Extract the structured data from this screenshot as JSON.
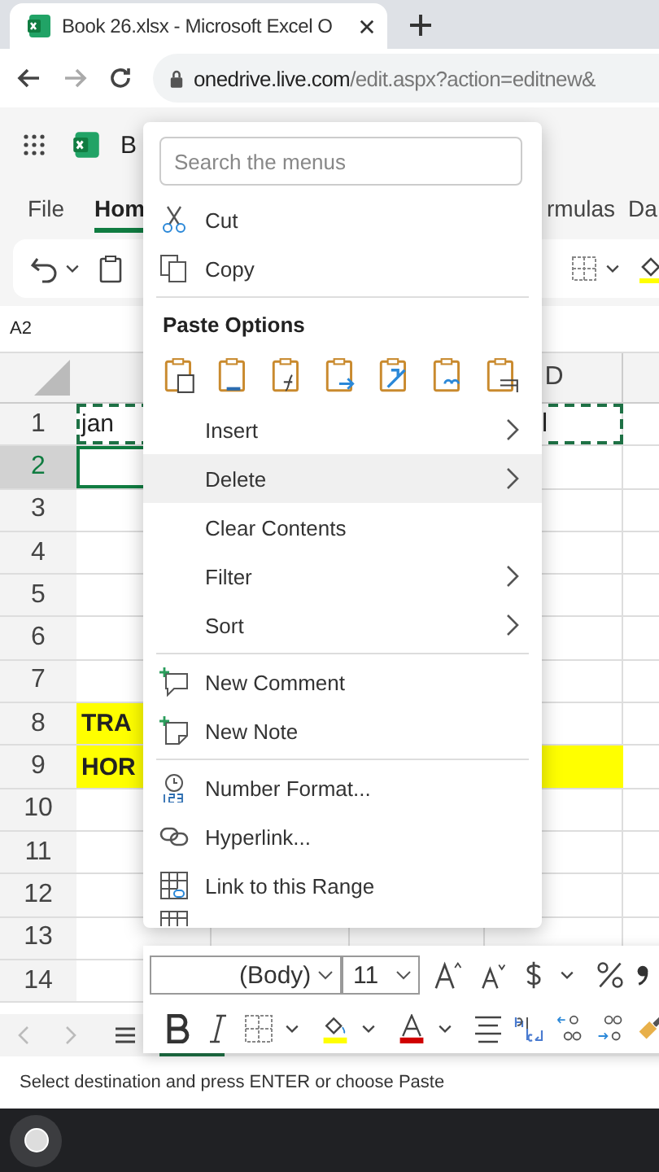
{
  "browser": {
    "tab_title": "Book 26.xlsx - Microsoft Excel O",
    "url_host": "onedrive.live.com",
    "url_path": "/edit.aspx?action=editnew&"
  },
  "app": {
    "file_name": "B"
  },
  "ribbon_tabs": [
    {
      "label": "File",
      "selected": false
    },
    {
      "label": "Hom",
      "selected": true
    },
    {
      "label": "rmulas",
      "selected": false
    },
    {
      "label": "Da",
      "selected": false
    }
  ],
  "name_box": "A2",
  "column_header": {
    "label": "D",
    "selected": false
  },
  "rows": [
    {
      "label": "1",
      "selected": false,
      "copied": true,
      "cells": [
        {
          "text": "jan",
          "filled": false,
          "selected": false
        },
        {
          "text": "l",
          "filled": false,
          "selected": false
        }
      ]
    },
    {
      "label": "2",
      "selected": true,
      "copied": false,
      "cells": [
        {
          "filled": false,
          "selected": true
        },
        {
          "filled": false,
          "selected": false
        }
      ]
    },
    {
      "label": "3",
      "selected": false,
      "copied": false,
      "cells": [
        {
          "filled": false,
          "selected": false
        },
        {
          "filled": false,
          "selected": false
        }
      ]
    },
    {
      "label": "4",
      "selected": false,
      "copied": false,
      "cells": [
        {
          "filled": false,
          "selected": false
        },
        {
          "filled": false,
          "selected": false
        }
      ]
    },
    {
      "label": "5",
      "selected": false,
      "copied": false,
      "cells": [
        {
          "filled": false,
          "selected": false
        },
        {
          "filled": false,
          "selected": false
        }
      ]
    },
    {
      "label": "6",
      "selected": false,
      "copied": false,
      "cells": [
        {
          "filled": false,
          "selected": false
        },
        {
          "filled": false,
          "selected": false
        }
      ]
    },
    {
      "label": "7",
      "selected": false,
      "copied": false,
      "cells": [
        {
          "filled": false,
          "selected": false
        },
        {
          "filled": false,
          "selected": false
        }
      ]
    },
    {
      "label": "8",
      "selected": false,
      "copied": false,
      "cells": [
        {
          "text": "TRA",
          "filled": true,
          "selected": false
        },
        {
          "filled": false,
          "selected": false
        }
      ]
    },
    {
      "label": "9",
      "selected": false,
      "copied": false,
      "cells": [
        {
          "text": "HOR",
          "filled": true,
          "selected": false
        },
        {
          "filled": true,
          "selected": false
        }
      ]
    },
    {
      "label": "10",
      "selected": false,
      "copied": false,
      "cells": [
        {
          "filled": false,
          "selected": false
        },
        {
          "filled": false,
          "selected": false
        }
      ]
    },
    {
      "label": "11",
      "selected": false,
      "copied": false,
      "cells": [
        {
          "filled": false,
          "selected": false
        },
        {
          "filled": false,
          "selected": false
        }
      ]
    },
    {
      "label": "12",
      "selected": false,
      "copied": false,
      "cells": [
        {
          "filled": false,
          "selected": false
        },
        {
          "filled": false,
          "selected": false
        }
      ]
    },
    {
      "label": "13",
      "selected": false,
      "copied": false,
      "cells": [
        {
          "filled": false,
          "selected": false
        },
        {
          "filled": false,
          "selected": false
        }
      ]
    },
    {
      "label": "14",
      "selected": false,
      "copied": false,
      "cells": [
        {
          "filled": false,
          "selected": false
        }
      ]
    }
  ],
  "context_menu": {
    "search": {
      "placeholder": "Search the menus"
    },
    "sections": [
      {
        "items": [
          {
            "label": "Cut",
            "has_submenu": false,
            "highlighted": false
          },
          {
            "label": "Copy",
            "has_submenu": false,
            "highlighted": false
          }
        ]
      },
      {
        "heading": "Paste Options"
      },
      {
        "items": [
          {
            "label": "Insert",
            "has_submenu": true,
            "highlighted": false
          },
          {
            "label": "Delete",
            "has_submenu": true,
            "highlighted": true
          },
          {
            "label": "Clear Contents",
            "has_submenu": false,
            "highlighted": false
          },
          {
            "label": "Filter",
            "has_submenu": true,
            "highlighted": false
          },
          {
            "label": "Sort",
            "has_submenu": true,
            "highlighted": false
          }
        ]
      },
      {
        "items": [
          {
            "label": "New Comment",
            "has_submenu": false,
            "highlighted": false
          },
          {
            "label": "New Note",
            "has_submenu": false,
            "highlighted": false
          }
        ]
      },
      {
        "items": [
          {
            "label": "Number Format...",
            "has_submenu": false,
            "highlighted": false
          },
          {
            "label": "Hyperlink...",
            "has_submenu": false,
            "highlighted": false
          },
          {
            "label": "Link to this Range",
            "has_submenu": false,
            "highlighted": false
          }
        ]
      }
    ]
  },
  "mini_toolbar": {
    "font": "(Body)",
    "size": "11"
  },
  "status_bar": "Select destination and press ENTER or choose Paste"
}
